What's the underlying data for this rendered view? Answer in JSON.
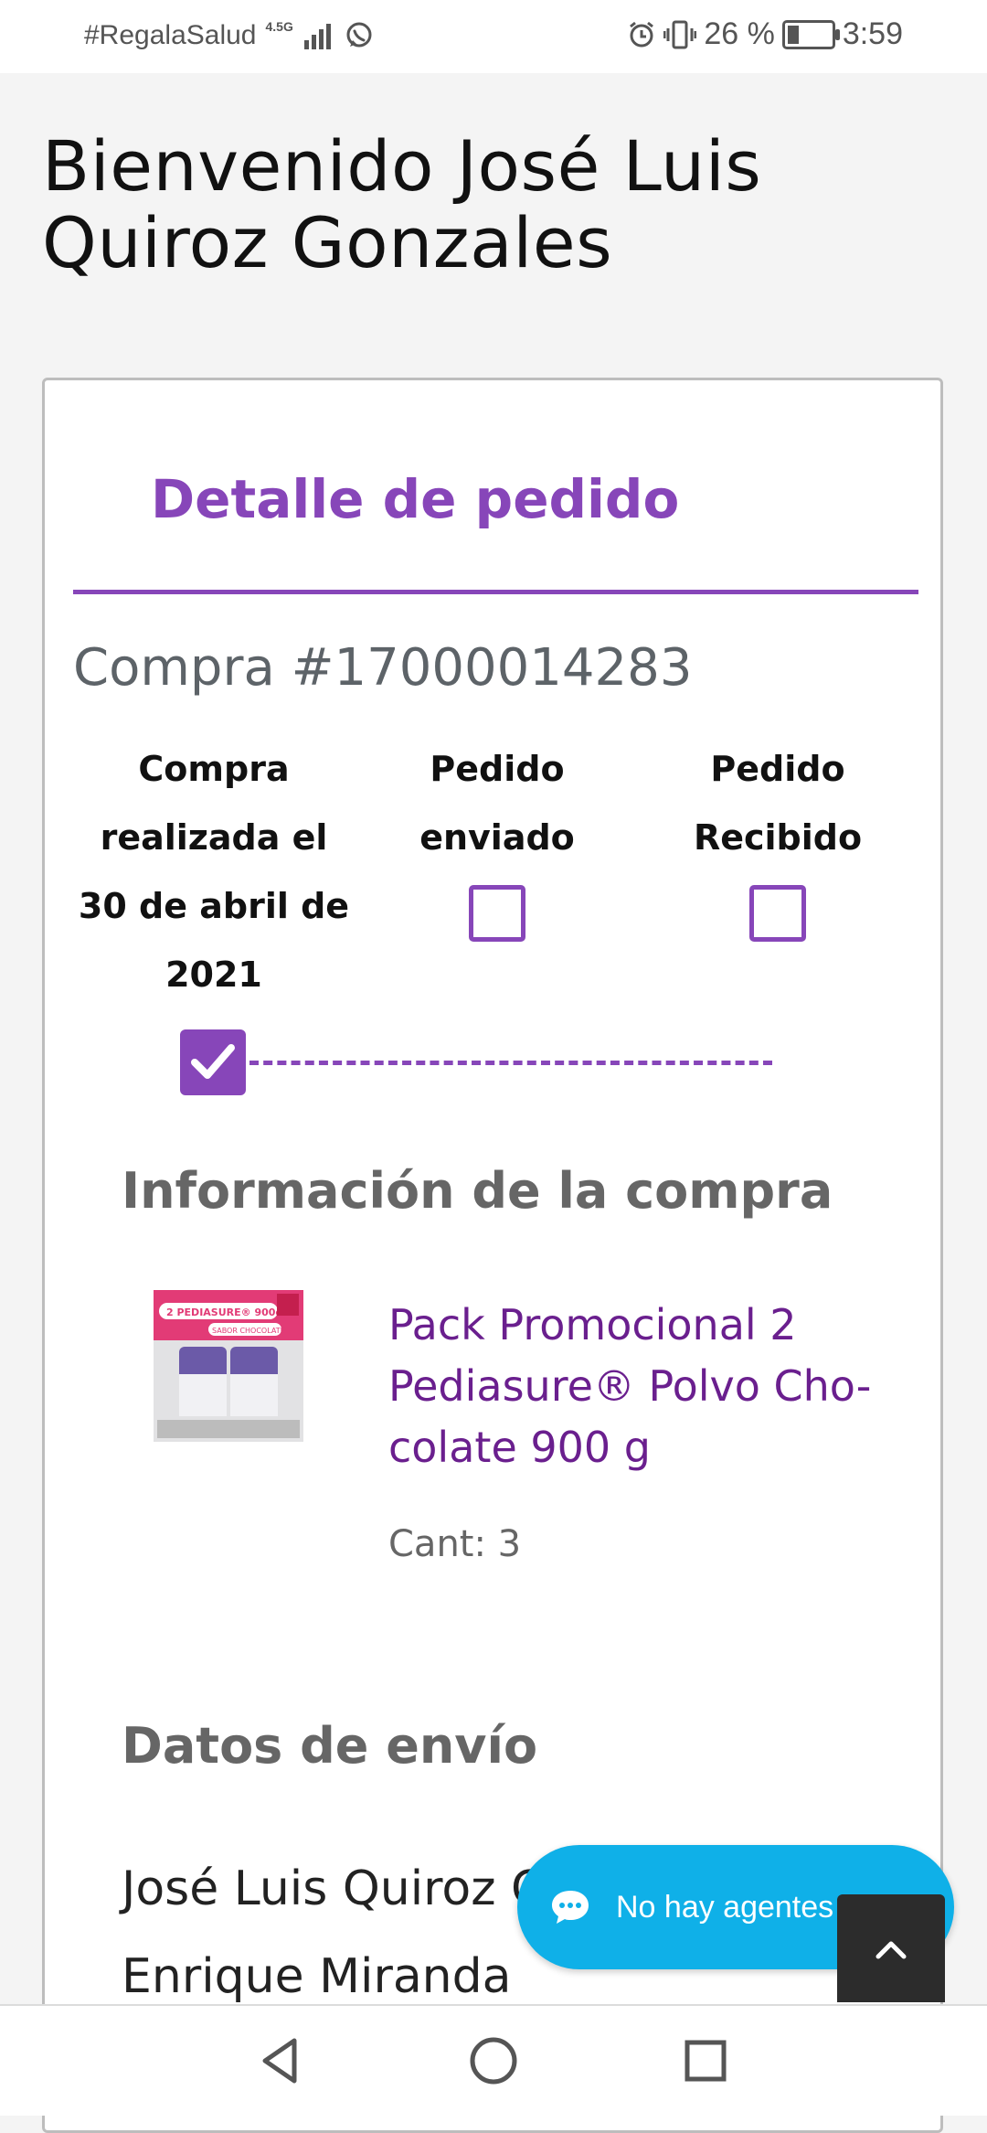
{
  "status_bar": {
    "carrier": "#RegalaSalud",
    "network": "4.5G",
    "battery_percent": "26 %",
    "battery_level": 0.26,
    "time": "3:59"
  },
  "welcome_title": "Bienvenido José Luis Quiroz Gonzales",
  "order_card": {
    "title": "Detalle de pedido",
    "order_number": "Compra #17000014283",
    "steps": [
      {
        "label": "Compra realizada el 30 de abril de 2021",
        "completed": true
      },
      {
        "label": "Pedido enviado",
        "completed": false
      },
      {
        "label": "Pedido Recibido",
        "completed": false
      }
    ],
    "purchase_info_title": "Información de la compra",
    "product": {
      "name": "Pack Promocional 2 Pediasure® Polvo Cho-colate 900 g",
      "quantity": "Cant: 3",
      "image_text": "2 PEDIASURE® 900g",
      "image_subtext": "SABOR CHOCOLATE"
    },
    "shipping_title": "Datos de envío",
    "shipping_lines": [
      "José Luis Quiroz Gonzales",
      "Enrique Miranda"
    ]
  },
  "chat": {
    "label": "No hay agentes"
  },
  "colors": {
    "accent": "#8746b9",
    "product_link": "#6a1f8e",
    "chat": "#0fb0e8"
  }
}
